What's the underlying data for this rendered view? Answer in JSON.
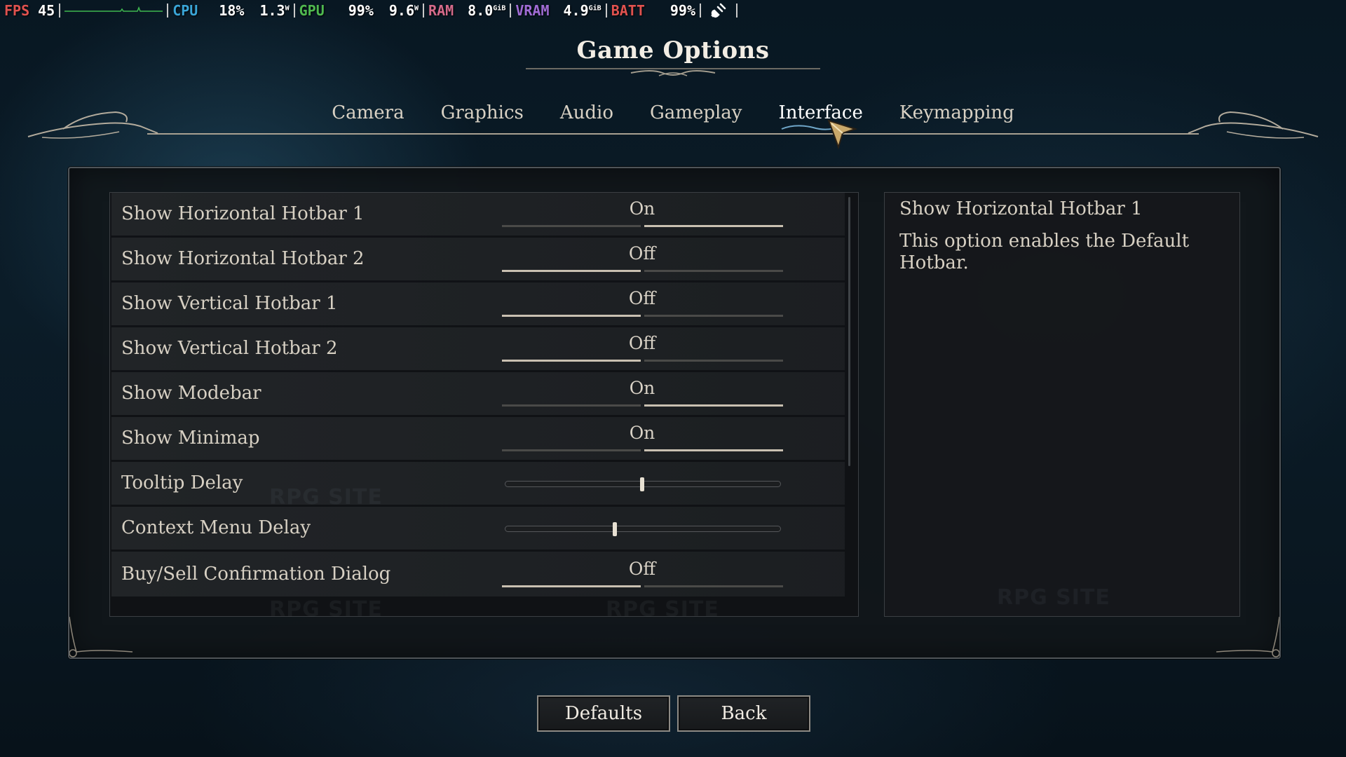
{
  "hud": {
    "fps_label": "FPS",
    "fps_value": "45",
    "cpu_label": "CPU",
    "cpu_load": "18%",
    "cpu_power": "1.3",
    "cpu_power_unit": "W",
    "gpu_label": "GPU",
    "gpu_load": "99%",
    "gpu_power": "9.6",
    "gpu_power_unit": "W",
    "ram_label": "RAM",
    "ram_value": "8.0",
    "ram_unit": "GiB",
    "vram_label": "VRAM",
    "vram_value": "4.9",
    "vram_unit": "GiB",
    "batt_label": "BATT",
    "batt_value": "99%",
    "colors": {
      "fps": "#e0524f",
      "cpu": "#3aa6d8",
      "gpu": "#4fb84f",
      "ram": "#d46a8a",
      "vram": "#a06cd5",
      "batt": "#e0524f",
      "graph": "#3fb84f"
    },
    "icons": {
      "charging": "plug-icon"
    }
  },
  "title": "Game Options",
  "tabs": [
    {
      "label": "Camera",
      "active": false
    },
    {
      "label": "Graphics",
      "active": false
    },
    {
      "label": "Audio",
      "active": false
    },
    {
      "label": "Gameplay",
      "active": false
    },
    {
      "label": "Interface",
      "active": true
    },
    {
      "label": "Keymapping",
      "active": false
    }
  ],
  "options": [
    {
      "label": "Show Horizontal Hotbar 1",
      "type": "toggle",
      "value": "On"
    },
    {
      "label": "Show Horizontal Hotbar 2",
      "type": "toggle",
      "value": "Off"
    },
    {
      "label": "Show Vertical Hotbar 1",
      "type": "toggle",
      "value": "Off"
    },
    {
      "label": "Show Vertical Hotbar 2",
      "type": "toggle",
      "value": "Off"
    },
    {
      "label": "Show Modebar",
      "type": "toggle",
      "value": "On"
    },
    {
      "label": "Show Minimap",
      "type": "toggle",
      "value": "On"
    },
    {
      "label": "Tooltip Delay",
      "type": "slider",
      "value": 0.5
    },
    {
      "label": "Context Menu Delay",
      "type": "slider",
      "value": 0.4
    },
    {
      "label": "Buy/Sell Confirmation Dialog",
      "type": "toggle",
      "value": "Off"
    }
  ],
  "description": {
    "title": "Show Horizontal Hotbar 1",
    "text": "This option enables the Default Hotbar."
  },
  "watermark": "RPG SITE",
  "buttons": {
    "defaults": "Defaults",
    "back": "Back"
  },
  "accent_color": "#c9c0b1"
}
